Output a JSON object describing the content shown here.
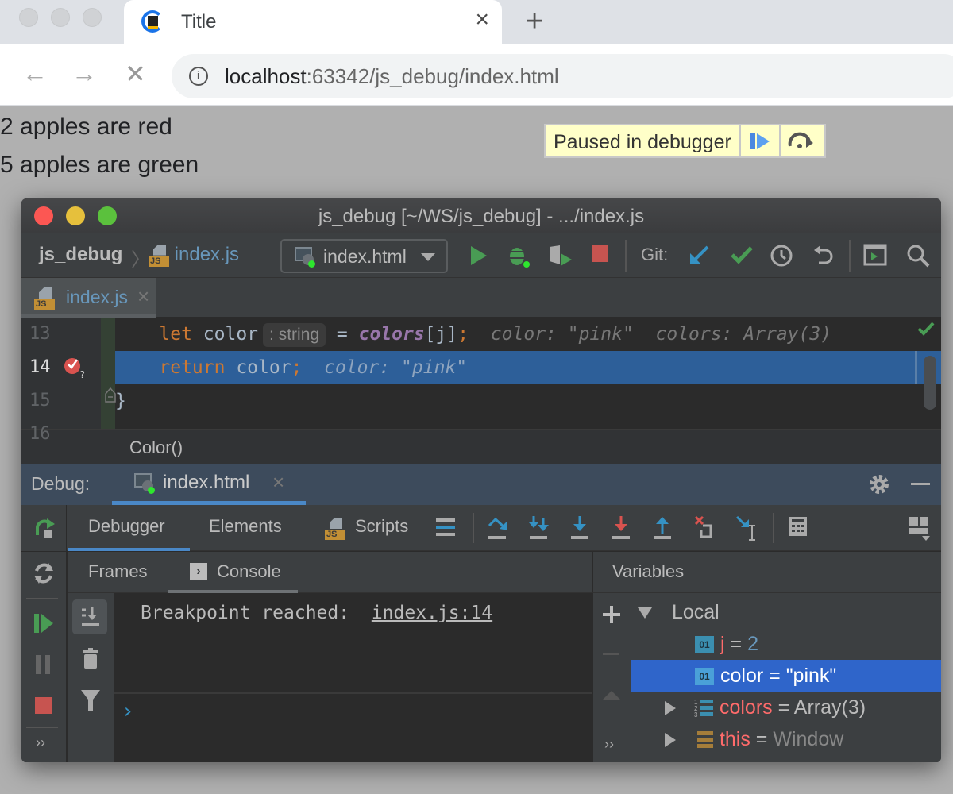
{
  "browser": {
    "tab_title": "Title",
    "tab_close": "×",
    "new_tab": "+",
    "back": "←",
    "forward": "→",
    "stop": "✕",
    "url_host": "localhost",
    "url_rest": ":63342/js_debug/index.html"
  },
  "page": {
    "lines": [
      "2 apples are red",
      "5 apples are green"
    ],
    "paused_label": "Paused in debugger"
  },
  "ide": {
    "window_title": "js_debug [~/WS/js_debug] - .../index.js",
    "breadcrumb": {
      "project": "js_debug",
      "file": "index.js",
      "separator": "〉"
    },
    "run_config": "index.html",
    "git_label": "Git:",
    "editor_tab": "index.js",
    "editor_tab_close": "×",
    "code": {
      "lines": [
        {
          "num": "13",
          "kw": "let",
          "text1": " color",
          "hint": ": string",
          "text2": " = ",
          "prop": "colors",
          "text3": "[j]",
          "semi": ";",
          "inline": "  color: \"pink\"  colors: Array(3)"
        },
        {
          "num": "14",
          "kw": "return",
          "text1": " color",
          "semi": ";",
          "inline": "  color: \"pink\""
        },
        {
          "num": "15",
          "text1": "}"
        },
        {
          "num": "16"
        }
      ],
      "js_label": "JS"
    },
    "function_bar": "Color()",
    "debug": {
      "label": "Debug:",
      "session_tab": "index.html",
      "session_close": "×",
      "tabs": [
        "Debugger",
        "Elements",
        "Scripts"
      ],
      "subtabs": [
        "Frames",
        "Console"
      ],
      "console_text": "Breakpoint reached:",
      "console_link": "index.js:14",
      "console_prompt": "›",
      "more": "››"
    },
    "variables": {
      "header": "Variables",
      "scope": "Local",
      "items": [
        {
          "icon": "01",
          "name": "j",
          "op": " = ",
          "value": "2",
          "type": "number"
        },
        {
          "icon": "01",
          "name": "color",
          "op": " = ",
          "value": "\"pink\"",
          "type": "string",
          "selected": true
        },
        {
          "icon": "array",
          "name": "colors",
          "op": " = ",
          "value": "Array(3)",
          "type": "object"
        },
        {
          "icon": "object",
          "name": "this",
          "op": " = ",
          "value": "Window",
          "type": "object"
        }
      ]
    }
  },
  "colors": {
    "accent": "#4a88c7",
    "selection": "#2d5f99",
    "var_selection": "#2f65ca",
    "run_green": "#499c54",
    "stop_red": "#c75450"
  }
}
